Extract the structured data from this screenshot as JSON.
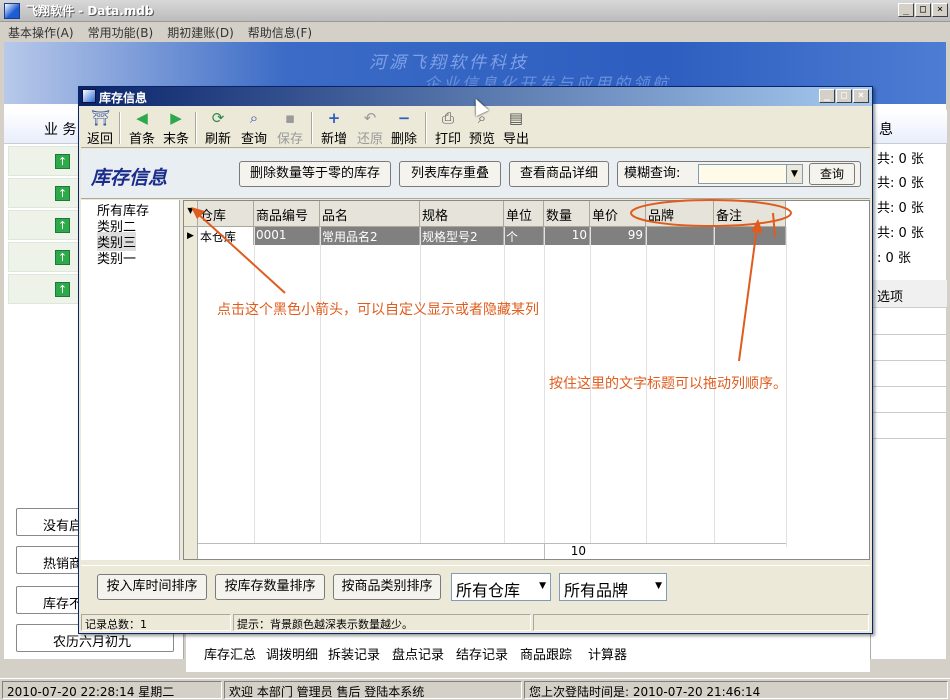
{
  "window": {
    "title": "飞翔软件 - Data.mdb",
    "controls": [
      "_",
      "□",
      "×"
    ]
  },
  "menu": [
    "基本操作(A)",
    "常用功能(B)",
    "期初建账(D)",
    "帮助信息(F)"
  ],
  "banner": {
    "line1": "河源飞翔软件科技",
    "line2": "企业信息化开发与应用的领航"
  },
  "left_panel": {
    "title": "业 务",
    "buttons": [
      "没有启",
      "热销商",
      "库存不",
      "农历六月初九"
    ]
  },
  "right_panel": {
    "header": "息",
    "lines": [
      "共: 0 张",
      "共: 0 张",
      "共: 0 张",
      "共: 0 张",
      ": 0 张"
    ],
    "option": "选项"
  },
  "bottom_panel": {
    "items": [
      "库存汇总",
      "调拨明细",
      "拆装记录",
      "盘点记录",
      "结存记录",
      "商品跟踪",
      "计算器"
    ]
  },
  "status": {
    "datetime": "2010-07-20 22:28:14  星期二",
    "welcome": "欢迎 本部门 管理员 售后 登陆本系统",
    "last_login": "您上次登陆时间是: 2010-07-20 21:46:14"
  },
  "dialog": {
    "title": "库存信息",
    "toolbar": [
      {
        "label": "返回",
        "icon": "door-icon",
        "glyph": "⛩",
        "color": "#3a5aa8"
      },
      {
        "label": "首条",
        "icon": "arrow-left-icon",
        "glyph": "◀",
        "color": "#2da84a"
      },
      {
        "label": "末条",
        "icon": "arrow-right-icon",
        "glyph": "▶",
        "color": "#2da84a"
      },
      {
        "label": "刷新",
        "icon": "refresh-icon",
        "glyph": "⟳",
        "color": "#2d8a4a"
      },
      {
        "label": "查询",
        "icon": "search-icon",
        "glyph": "⌕",
        "color": "#3a5aa8"
      },
      {
        "label": "保存",
        "icon": "save-icon",
        "glyph": "▪",
        "color": "#9a9a9a",
        "disabled": true
      },
      {
        "label": "新增",
        "icon": "plus-icon",
        "glyph": "+",
        "color": "#2d5ec0"
      },
      {
        "label": "还原",
        "icon": "undo-icon",
        "glyph": "↶",
        "color": "#9a9a9a",
        "disabled": true
      },
      {
        "label": "删除",
        "icon": "minus-icon",
        "glyph": "−",
        "color": "#2d5ec0"
      },
      {
        "label": "打印",
        "icon": "printer-icon",
        "glyph": "⎙",
        "color": "#555"
      },
      {
        "label": "预览",
        "icon": "preview-icon",
        "glyph": "⌕",
        "color": "#555"
      },
      {
        "label": "导出",
        "icon": "export-icon",
        "glyph": "▤",
        "color": "#555"
      }
    ],
    "header_title": "库存信息",
    "header_buttons": [
      "删除数量等于零的库存",
      "列表库存重叠",
      "查看商品详细"
    ],
    "search_label": "模糊查询:",
    "search_value": "",
    "search_button": "查询",
    "tree": [
      "所有库存",
      "类别二",
      "类别三",
      "类别一"
    ],
    "grid": {
      "columns": [
        "仓库",
        "商品编号",
        "品名",
        "规格",
        "单位",
        "数量",
        "单价",
        "品牌",
        "备注"
      ],
      "rows": [
        [
          "本仓库",
          "0001",
          "常用品名2",
          "规格型号2",
          "个",
          "10",
          "99",
          "",
          ""
        ]
      ],
      "footer_total": "10"
    },
    "annotations": {
      "arrow_hint": "点击这个黑色小箭头，可以自定义显示或者隐藏某列",
      "drag_hint": "按住这里的文字标题可以拖动列顺序。"
    },
    "bottom_buttons": [
      "按入库时间排序",
      "按库存数量排序",
      "按商品类别排序"
    ],
    "selects": [
      "所有仓库",
      "所有品牌"
    ],
    "status": {
      "count": "记录总数：1",
      "tip": "提示：背景颜色越深表示数量越少。"
    },
    "accent": "#e05c1e"
  }
}
